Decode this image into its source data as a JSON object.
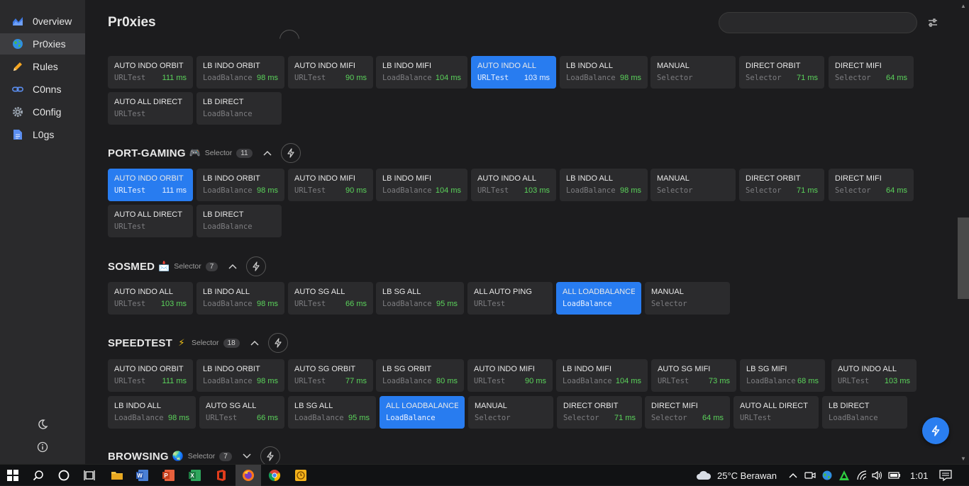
{
  "sidebar": {
    "items": [
      {
        "label": "0verview",
        "icon": "chart-icon",
        "active": false
      },
      {
        "label": "Pr0xies",
        "icon": "globe-icon",
        "active": true
      },
      {
        "label": "Rules",
        "icon": "pencil-icon",
        "active": false
      },
      {
        "label": "C0nns",
        "icon": "link-icon",
        "active": false
      },
      {
        "label": "C0nfig",
        "icon": "gear-icon",
        "active": false
      },
      {
        "label": "L0gs",
        "icon": "document-icon",
        "active": false
      }
    ]
  },
  "page": {
    "title": "Pr0xies",
    "search_placeholder": ""
  },
  "groups": [
    {
      "name": "",
      "type": "",
      "count": "",
      "proxies": [
        {
          "name": "AUTO INDO ORBIT",
          "type": "URLTest",
          "latency": "111 ms",
          "selected": false
        },
        {
          "name": "LB INDO ORBIT",
          "type": "LoadBalance",
          "latency": "98 ms",
          "selected": false
        },
        {
          "name": "AUTO INDO MIFI",
          "type": "URLTest",
          "latency": "90 ms",
          "selected": false
        },
        {
          "name": "LB INDO MIFI",
          "type": "LoadBalance",
          "latency": "104 ms",
          "selected": false
        },
        {
          "name": "AUTO INDO ALL",
          "type": "URLTest",
          "latency": "103 ms",
          "selected": true
        },
        {
          "name": "LB INDO ALL",
          "type": "LoadBalance",
          "latency": "98 ms",
          "selected": false
        },
        {
          "name": "MANUAL",
          "type": "Selector",
          "latency": "",
          "selected": false
        },
        {
          "name": "DIRECT ORBIT",
          "type": "Selector",
          "latency": "71 ms",
          "selected": false
        },
        {
          "name": "DIRECT MIFI",
          "type": "Selector",
          "latency": "64 ms",
          "selected": false
        },
        {
          "name": "AUTO ALL DIRECT",
          "type": "URLTest",
          "latency": "",
          "selected": false
        },
        {
          "name": "LB DIRECT",
          "type": "LoadBalance",
          "latency": "",
          "selected": false
        }
      ]
    },
    {
      "name": "PORT-GAMING",
      "emoji": "🎮",
      "type": "Selector",
      "count": "11",
      "proxies": [
        {
          "name": "AUTO INDO ORBIT",
          "type": "URLTest",
          "latency": "111 ms",
          "selected": true
        },
        {
          "name": "LB INDO ORBIT",
          "type": "LoadBalance",
          "latency": "98 ms",
          "selected": false
        },
        {
          "name": "AUTO INDO MIFI",
          "type": "URLTest",
          "latency": "90 ms",
          "selected": false
        },
        {
          "name": "LB INDO MIFI",
          "type": "LoadBalance",
          "latency": "104 ms",
          "selected": false
        },
        {
          "name": "AUTO INDO ALL",
          "type": "URLTest",
          "latency": "103 ms",
          "selected": false
        },
        {
          "name": "LB INDO ALL",
          "type": "LoadBalance",
          "latency": "98 ms",
          "selected": false
        },
        {
          "name": "MANUAL",
          "type": "Selector",
          "latency": "",
          "selected": false
        },
        {
          "name": "DIRECT ORBIT",
          "type": "Selector",
          "latency": "71 ms",
          "selected": false
        },
        {
          "name": "DIRECT MIFI",
          "type": "Selector",
          "latency": "64 ms",
          "selected": false
        },
        {
          "name": "AUTO ALL DIRECT",
          "type": "URLTest",
          "latency": "",
          "selected": false
        },
        {
          "name": "LB DIRECT",
          "type": "LoadBalance",
          "latency": "",
          "selected": false
        }
      ]
    },
    {
      "name": "SOSMED",
      "emoji": "📩",
      "type": "Selector",
      "count": "7",
      "proxies": [
        {
          "name": "AUTO INDO ALL",
          "type": "URLTest",
          "latency": "103 ms",
          "selected": false
        },
        {
          "name": "LB INDO ALL",
          "type": "LoadBalance",
          "latency": "98 ms",
          "selected": false
        },
        {
          "name": "AUTO SG ALL",
          "type": "URLTest",
          "latency": "66 ms",
          "selected": false
        },
        {
          "name": "LB SG ALL",
          "type": "LoadBalance",
          "latency": "95 ms",
          "selected": false
        },
        {
          "name": "ALL AUTO PING",
          "type": "URLTest",
          "latency": "",
          "selected": false
        },
        {
          "name": "ALL LOADBALANCE",
          "type": "LoadBalance",
          "latency": "",
          "selected": true
        },
        {
          "name": "MANUAL",
          "type": "Selector",
          "latency": "",
          "selected": false
        }
      ]
    },
    {
      "name": "SPEEDTEST",
      "emoji": "⚡",
      "type": "Selector",
      "count": "18",
      "proxies": [
        {
          "name": "AUTO INDO ORBIT",
          "type": "URLTest",
          "latency": "111 ms",
          "selected": false
        },
        {
          "name": "LB INDO ORBIT",
          "type": "LoadBalance",
          "latency": "98 ms",
          "selected": false
        },
        {
          "name": "AUTO SG ORBIT",
          "type": "URLTest",
          "latency": "77 ms",
          "selected": false
        },
        {
          "name": "LB SG ORBIT",
          "type": "LoadBalance",
          "latency": "80 ms",
          "selected": false
        },
        {
          "name": "AUTO INDO MIFI",
          "type": "URLTest",
          "latency": "90 ms",
          "selected": false
        },
        {
          "name": "LB INDO MIFI",
          "type": "LoadBalance",
          "latency": "104 ms",
          "selected": false
        },
        {
          "name": "AUTO SG MIFI",
          "type": "URLTest",
          "latency": "73 ms",
          "selected": false
        },
        {
          "name": "LB SG MIFI",
          "type": "LoadBalance",
          "latency": "68 ms",
          "selected": false
        },
        {
          "name": "AUTO INDO ALL",
          "type": "URLTest",
          "latency": "103 ms",
          "selected": false
        },
        {
          "name": "LB INDO ALL",
          "type": "LoadBalance",
          "latency": "98 ms",
          "selected": false
        },
        {
          "name": "AUTO SG ALL",
          "type": "URLTest",
          "latency": "66 ms",
          "selected": false
        },
        {
          "name": "LB SG ALL",
          "type": "LoadBalance",
          "latency": "95 ms",
          "selected": false
        },
        {
          "name": "ALL LOADBALANCE",
          "type": "LoadBalance",
          "latency": "",
          "selected": true
        },
        {
          "name": "MANUAL",
          "type": "Selector",
          "latency": "",
          "selected": false
        },
        {
          "name": "DIRECT ORBIT",
          "type": "Selector",
          "latency": "71 ms",
          "selected": false
        },
        {
          "name": "DIRECT MIFI",
          "type": "Selector",
          "latency": "64 ms",
          "selected": false
        },
        {
          "name": "AUTO ALL DIRECT",
          "type": "URLTest",
          "latency": "",
          "selected": false
        },
        {
          "name": "LB DIRECT",
          "type": "LoadBalance",
          "latency": "",
          "selected": false
        }
      ]
    },
    {
      "name": "BROWSING",
      "emoji": "🌏",
      "type": "Selector",
      "count": "7",
      "proxies": []
    }
  ],
  "taskbar": {
    "weather": "25°C  Berawan",
    "time": "1:01"
  },
  "colors": {
    "accent": "#287cf0",
    "latency_good": "#5bd35b",
    "card_bg": "#2b2b2d",
    "sidebar_bg": "#2a2a2c"
  }
}
